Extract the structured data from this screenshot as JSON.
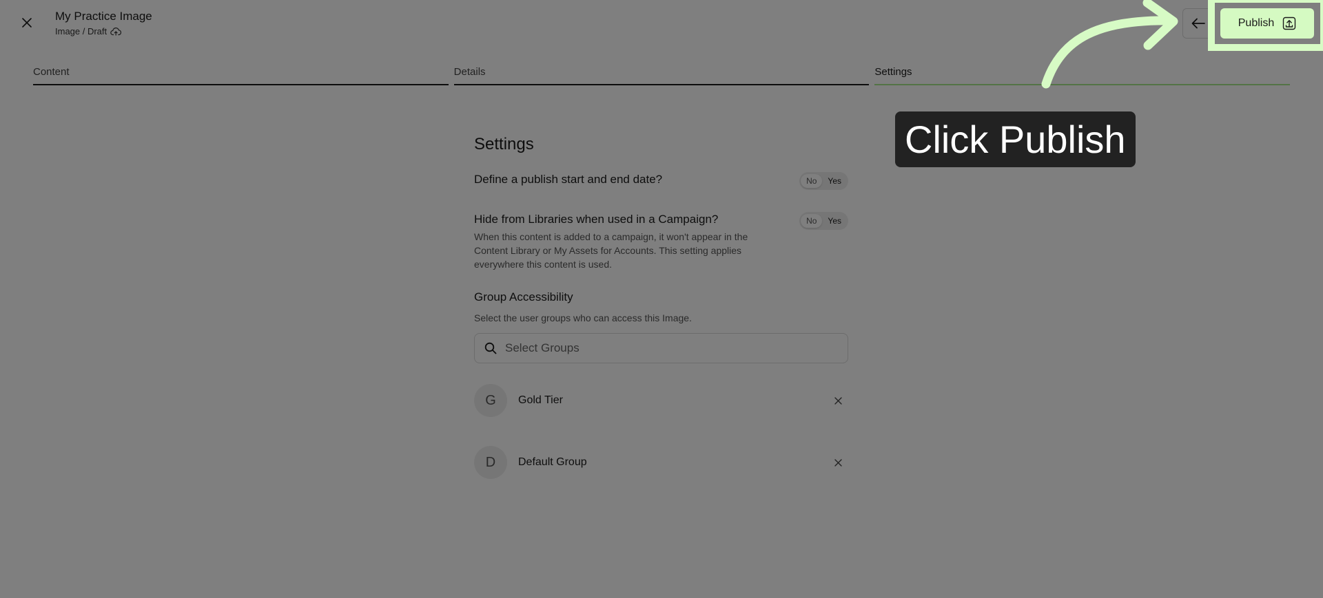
{
  "header": {
    "title": "My Practice Image",
    "breadcrumb": "Image / Draft",
    "publish_label": "Publish"
  },
  "steps": [
    {
      "label": "Content",
      "active": false
    },
    {
      "label": "Details",
      "active": false
    },
    {
      "label": "Settings",
      "active": true
    }
  ],
  "settings": {
    "title": "Settings",
    "schedule": {
      "label": "Define a publish start and end date?",
      "no": "No",
      "yes": "Yes",
      "selected": "No"
    },
    "hide": {
      "label": "Hide from Libraries when used in a Campaign?",
      "help": "When this content is added to a campaign, it won't appear in the Content Library or My Assets for Accounts. This setting applies everywhere this content is used.",
      "no": "No",
      "yes": "Yes",
      "selected": "No"
    },
    "groups": {
      "title": "Group Accessibility",
      "help": "Select the user groups who can access this Image.",
      "search_placeholder": "Select Groups",
      "items": [
        {
          "initial": "G",
          "name": "Gold Tier"
        },
        {
          "initial": "D",
          "name": "Default Group"
        }
      ]
    }
  },
  "tutorial": {
    "callout": "Click Publish",
    "highlight_color": "#d7fbc5"
  },
  "colors": {
    "publish_button": "#d5fac2",
    "active_step": "#a7e68c",
    "overlay": "rgba(0,0,0,0.5)",
    "callout_bg": "#222222"
  },
  "icons": {
    "close": "close-icon",
    "draft_status": "cloud-upload-icon",
    "back": "arrow-left-icon",
    "publish": "publish-upload-icon",
    "search": "search-icon",
    "remove": "close-icon"
  }
}
